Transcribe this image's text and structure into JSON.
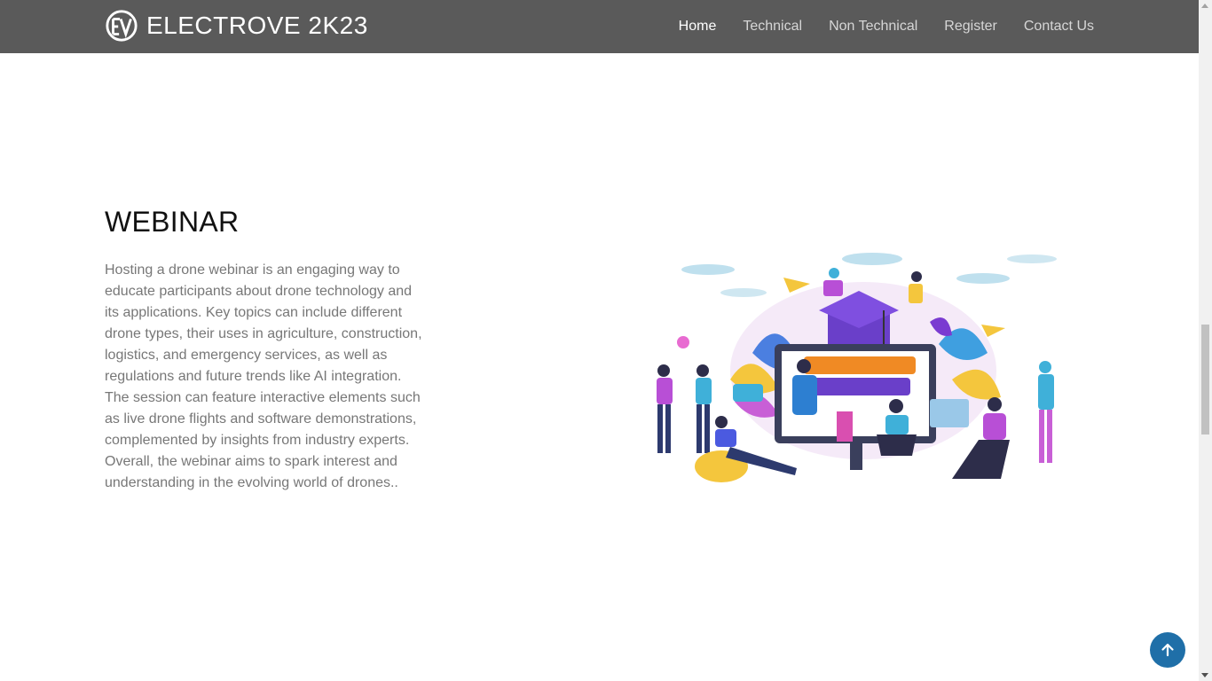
{
  "nav": {
    "brand": "ELECTROVE 2K23",
    "links": [
      "Home",
      "Technical",
      "Non Technical",
      "Register",
      "Contact Us"
    ],
    "active": "Home"
  },
  "section": {
    "title": "WEBINAR",
    "body": "Hosting a drone webinar is an engaging way to educate participants about drone technology and its applications. Key topics can include different drone types, their uses in agriculture, construction, logistics, and emergency services, as well as regulations and future trends like AI integration. The session can feature interactive elements such as live drone flights and software demonstrations, complemented by insights from industry experts. Overall, the webinar aims to spark interest and understanding in the evolving world of drones.."
  },
  "icons": {
    "logo": "ev-logo-icon",
    "back_to_top": "arrow-up-icon"
  },
  "colors": {
    "navbar": "#5a5a5a",
    "nav_link": "#d6d6d6",
    "nav_active": "#ffffff",
    "body_text": "#777777",
    "back_to_top": "#1f6fa8"
  }
}
